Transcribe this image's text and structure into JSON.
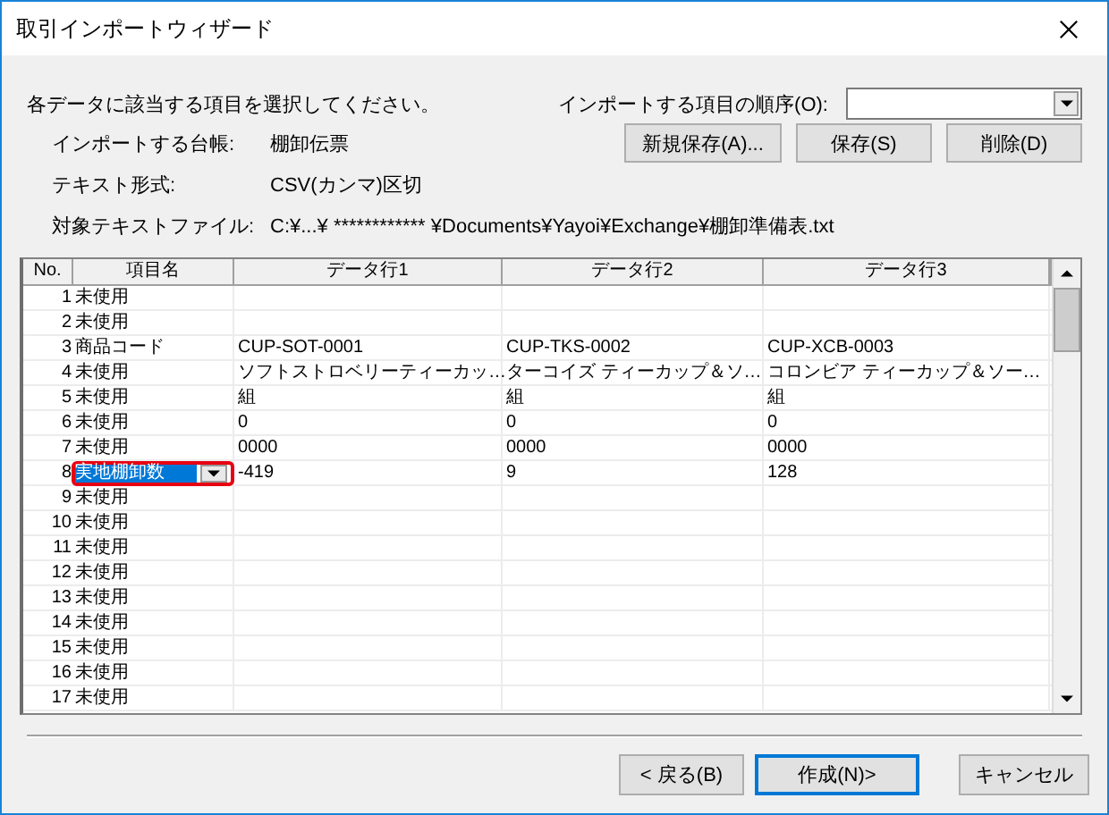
{
  "window": {
    "title": "取引インポートウィザード"
  },
  "instruction": "各データに該当する項目を選択してください。",
  "order": {
    "label": "インポートする項目の順序(O):"
  },
  "info": [
    {
      "label": "インポートする台帳:",
      "value": "棚卸伝票"
    },
    {
      "label": "テキスト形式:",
      "value": "CSV(カンマ)区切"
    },
    {
      "label": "対象テキストファイル:",
      "value": "C:¥...¥  ************  ¥Documents¥Yayoi¥Exchange¥棚卸準備表.txt"
    }
  ],
  "order_buttons": [
    "新規保存(A)...",
    "保存(S)",
    "削除(D)"
  ],
  "table": {
    "columns": [
      "No.",
      "項目名",
      "データ行1",
      "データ行2",
      "データ行3"
    ],
    "rows": [
      {
        "no": "1",
        "item": "未使用",
        "cells": [
          "",
          "",
          ""
        ],
        "selected": false
      },
      {
        "no": "2",
        "item": "未使用",
        "cells": [
          "",
          "",
          ""
        ],
        "selected": false
      },
      {
        "no": "3",
        "item": "商品コード",
        "cells": [
          "CUP-SOT-0001",
          "CUP-TKS-0002",
          "CUP-XCB-0003"
        ],
        "selected": false
      },
      {
        "no": "4",
        "item": "未使用",
        "cells": [
          "ソフトストロベリーティーカッ…",
          "ターコイズ ティーカップ＆ソ…",
          "コロンビア ティーカップ＆ソー…"
        ],
        "selected": false
      },
      {
        "no": "5",
        "item": "未使用",
        "cells": [
          "組",
          "組",
          "組"
        ],
        "selected": false
      },
      {
        "no": "6",
        "item": "未使用",
        "cells": [
          "0",
          "0",
          "0"
        ],
        "selected": false
      },
      {
        "no": "7",
        "item": "未使用",
        "cells": [
          "0000",
          "0000",
          "0000"
        ],
        "selected": false
      },
      {
        "no": "8",
        "item": "実地棚卸数",
        "cells": [
          "-419",
          "9",
          "128"
        ],
        "selected": true
      },
      {
        "no": "9",
        "item": "未使用",
        "cells": [
          "",
          "",
          ""
        ],
        "selected": false
      },
      {
        "no": "10",
        "item": "未使用",
        "cells": [
          "",
          "",
          ""
        ],
        "selected": false
      },
      {
        "no": "11",
        "item": "未使用",
        "cells": [
          "",
          "",
          ""
        ],
        "selected": false
      },
      {
        "no": "12",
        "item": "未使用",
        "cells": [
          "",
          "",
          ""
        ],
        "selected": false
      },
      {
        "no": "13",
        "item": "未使用",
        "cells": [
          "",
          "",
          ""
        ],
        "selected": false
      },
      {
        "no": "14",
        "item": "未使用",
        "cells": [
          "",
          "",
          ""
        ],
        "selected": false
      },
      {
        "no": "15",
        "item": "未使用",
        "cells": [
          "",
          "",
          ""
        ],
        "selected": false
      },
      {
        "no": "16",
        "item": "未使用",
        "cells": [
          "",
          "",
          ""
        ],
        "selected": false
      },
      {
        "no": "17",
        "item": "未使用",
        "cells": [
          "",
          "",
          ""
        ],
        "selected": false
      }
    ]
  },
  "buttons": [
    {
      "label": "< 戻る(B)",
      "default": false
    },
    {
      "label": "作成(N)>",
      "default": true
    },
    {
      "label": "キャンセル",
      "default": false
    }
  ]
}
